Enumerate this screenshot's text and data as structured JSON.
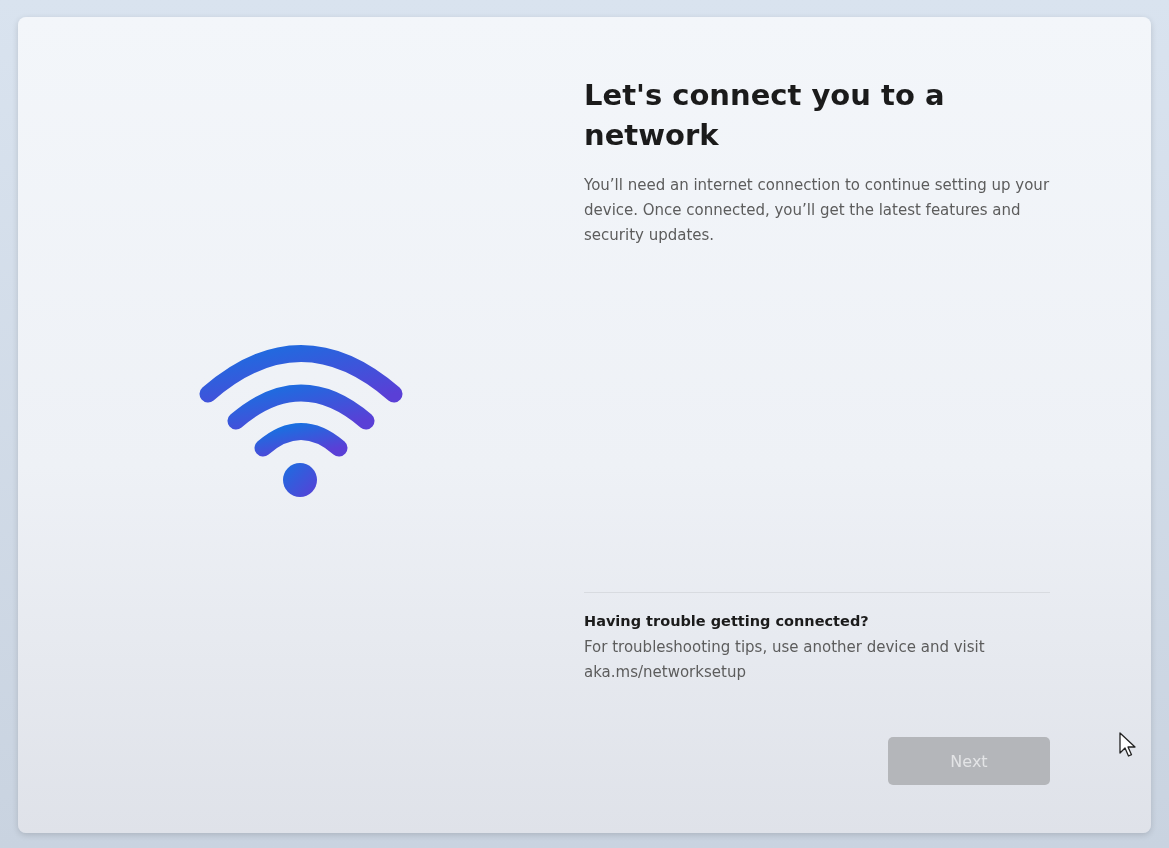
{
  "page": {
    "title": "Let's connect you to a network",
    "description": "You’ll need an internet connection to continue setting up your device. Once connected, you’ll get the latest features and security updates.",
    "help": {
      "heading": "Having trouble getting connected?",
      "text": "For troubleshooting tips, use another device and visit aka.ms/networksetup"
    },
    "buttons": [
      {
        "label": "Next",
        "disabled": true
      }
    ]
  }
}
